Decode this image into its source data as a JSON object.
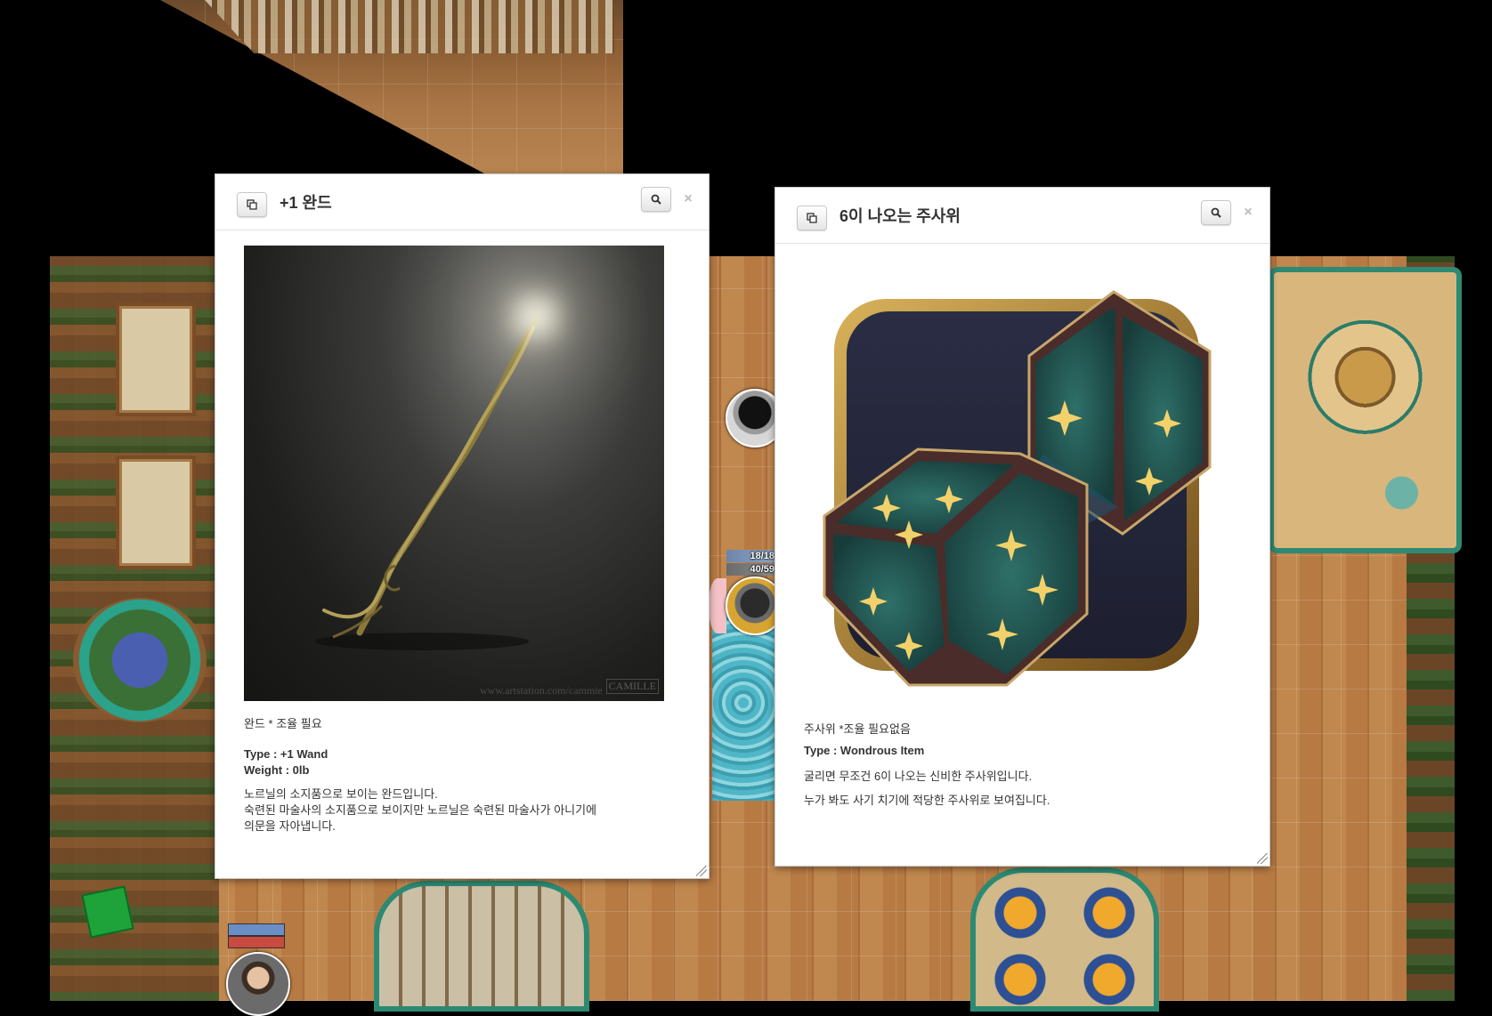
{
  "tokens": {
    "hp_top": "18/18",
    "hp_bottom": "40/59"
  },
  "wand_dialog": {
    "title": "+1 완드",
    "copy_icon": "copy-icon",
    "zoom_icon": "magnifier-icon",
    "close_label": "×",
    "image_watermark": "www.artstation.com/cammie",
    "image_signature": "CAMILLE",
    "subtitle": "완드 * 조율 필요",
    "type_line": "Type : +1 Wand",
    "weight_line": "Weight : 0lb",
    "description_1": "노르닐의 소지품으로 보이는 완드입니다.",
    "description_2": "숙련된 마술사의 소지품으로 보이지만 노르닐은 숙련된 마술사가 아니기에",
    "description_3": "의문을 자아냅니다."
  },
  "dice_dialog": {
    "title": "6이 나오는 주사위",
    "copy_icon": "copy-icon",
    "zoom_icon": "magnifier-icon",
    "close_label": "×",
    "subtitle": "주사위 *조율 필요없음",
    "type_line": "Type : Wondrous Item",
    "description_1": "굴리면 무조건 6이 나오는 신비한 주사위입니다.",
    "description_2": "누가 봐도 사기 치기에 적당한 주사위로 보여집니다."
  },
  "colors": {
    "dialog_bg": "#ffffff",
    "title_text": "#333333",
    "floor_wood": "#b5783f",
    "trim_teal": "#2c8a73"
  }
}
